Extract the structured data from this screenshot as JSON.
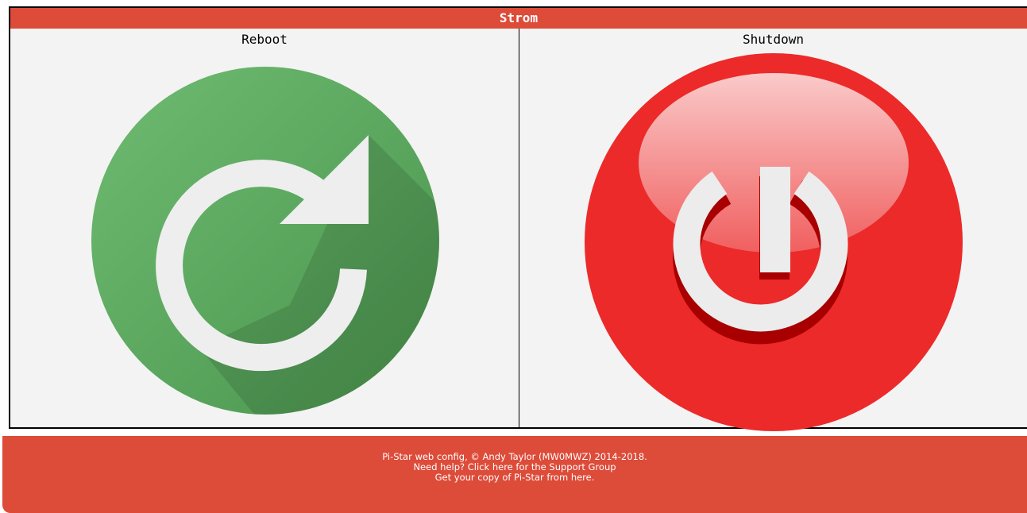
{
  "section": {
    "title": "Strom"
  },
  "reboot": {
    "label": "Reboot"
  },
  "shutdown": {
    "label": "Shutdown"
  },
  "footer": {
    "line1": "Pi-Star web config, © Andy Taylor (MW0MWZ) 2014-2018.",
    "line2": "Need help? Click here for the Support Group",
    "line3": "Get your copy of Pi-Star from here."
  },
  "colors": {
    "header": "#dd4b39",
    "reboot_green": "#5ba35f",
    "shutdown_red": "#ec2a2a",
    "panel_bg": "#f3f3f3"
  },
  "icons": {
    "reboot": "reboot-icon",
    "shutdown": "power-icon"
  }
}
